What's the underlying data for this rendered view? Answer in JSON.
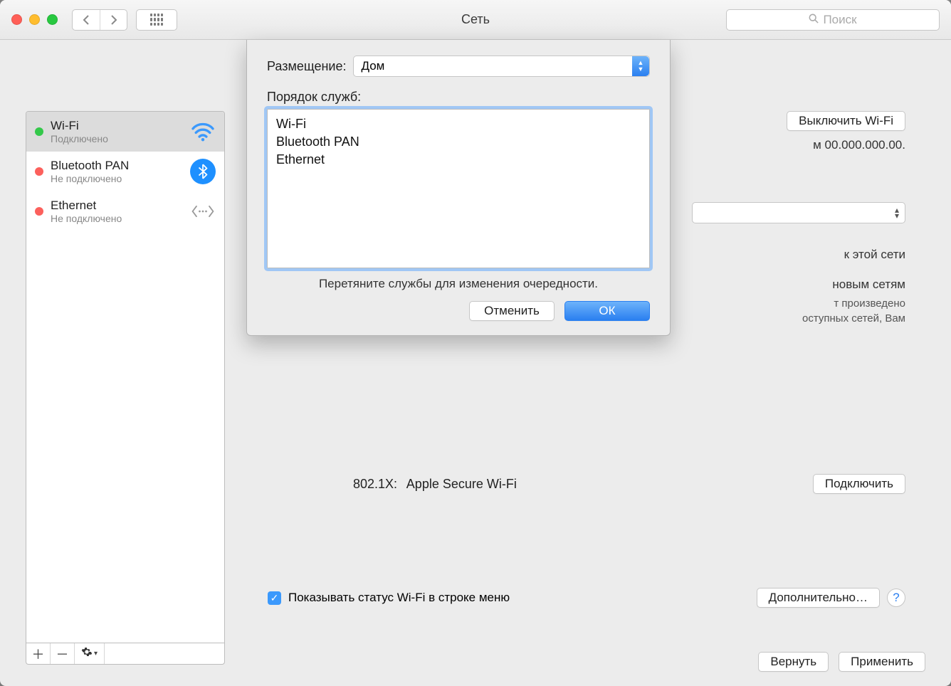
{
  "window": {
    "title": "Сеть"
  },
  "search": {
    "placeholder": "Поиск"
  },
  "sidebar": {
    "items": [
      {
        "name": "Wi-Fi",
        "status": "Подключено",
        "dot": "green",
        "icon": "wifi",
        "selected": true
      },
      {
        "name": "Bluetooth PAN",
        "status": "Не подключено",
        "dot": "red",
        "icon": "bluetooth",
        "selected": false
      },
      {
        "name": "Ethernet",
        "status": "Не подключено",
        "dot": "red",
        "icon": "ethernet",
        "selected": false
      }
    ]
  },
  "main": {
    "turn_off_wifi": "Выключить Wi-Fi",
    "ip_fragment": "м 00.000.000.00.",
    "peek1": "к этой сети",
    "peek2": "новым сетям",
    "peek3a": "т произведено",
    "peek3b": "оступных сетей, Вам",
    "row_8021x_label": "802.1X:",
    "row_8021x_value": "Apple Secure Wi-Fi",
    "connect_btn": "Подключить",
    "show_status_checkbox": "Показывать статус Wi-Fi в строке меню",
    "advanced_btn": "Дополнительно…"
  },
  "footer": {
    "revert": "Вернуть",
    "apply": "Применить"
  },
  "sheet": {
    "location_label": "Размещение:",
    "location_value": "Дом",
    "order_label": "Порядок служб:",
    "order_items": [
      "Wi-Fi",
      "Bluetooth PAN",
      "Ethernet"
    ],
    "hint": "Перетяните службы для изменения очередности.",
    "cancel": "Отменить",
    "ok": "ОК"
  }
}
